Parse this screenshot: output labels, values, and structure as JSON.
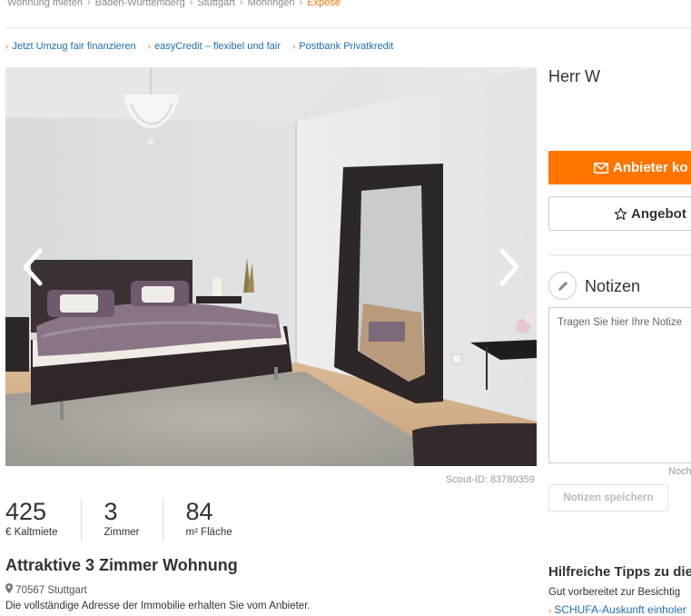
{
  "breadcrumb": {
    "items": [
      "Wohnung mieten",
      "Baden-Württemberg",
      "Stuttgart",
      "Möhringen"
    ],
    "active": "Exposé"
  },
  "promo_links": [
    {
      "label": "Jetzt Umzug fair finanzieren"
    },
    {
      "label": "easyCredit – flexibel und fair"
    },
    {
      "label": "Postbank Privatkredit"
    }
  ],
  "gallery": {
    "scout_id": "Scout-ID: 83780359"
  },
  "facts": [
    {
      "value": "425",
      "label": "€ Kaltmiete"
    },
    {
      "value": "3",
      "label": "Zimmer"
    },
    {
      "value": "84",
      "label": "m² Fläche"
    }
  ],
  "listing": {
    "title": "Attraktive 3 Zimmer Wohnung",
    "location": "70567 Stuttgart",
    "address_note": "Die vollständige Adresse der Immobilie erhalten Sie vom Anbieter."
  },
  "contact": {
    "name": "Herr W",
    "contact_button": "Anbieter ko",
    "fav_button": "Angebot"
  },
  "notes": {
    "title": "Notizen",
    "placeholder": "Tragen Sie hier Ihre Notize",
    "counter": "Noch",
    "save_button": "Notizen speichern"
  },
  "tips": {
    "title": "Hilfreiche Tipps zu die",
    "line": "Gut vorbereitet zur Besichtig",
    "link": "SCHUFA-Auskunft einholer"
  },
  "colors": {
    "accent": "#ff7500",
    "link": "#1f6fb3"
  }
}
